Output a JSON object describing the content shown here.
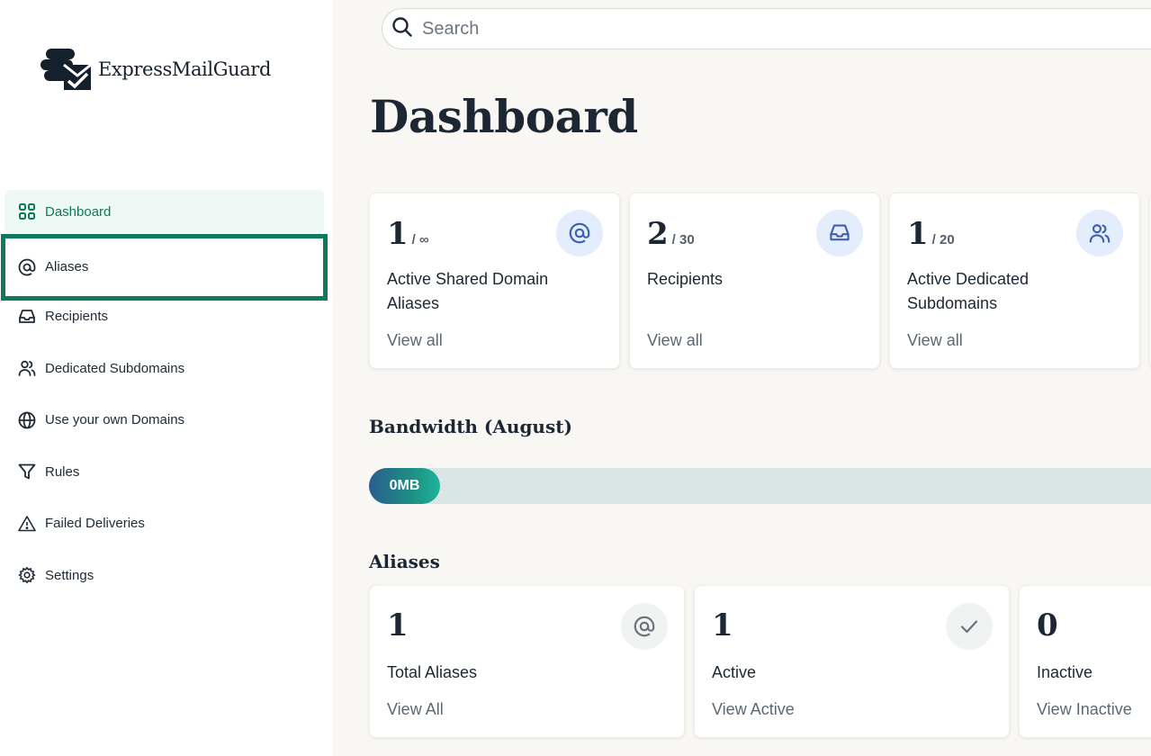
{
  "app": {
    "brand": "ExpressMailGuard"
  },
  "search": {
    "placeholder": "Search"
  },
  "sidebar": {
    "items": [
      {
        "label": "Dashboard",
        "icon": "grid-icon"
      },
      {
        "label": "Aliases",
        "icon": "at-icon"
      },
      {
        "label": "Recipients",
        "icon": "inbox-icon"
      },
      {
        "label": "Dedicated Subdomains",
        "icon": "users-icon"
      },
      {
        "label": "Use your own Domains",
        "icon": "globe-icon"
      },
      {
        "label": "Rules",
        "icon": "filter-icon"
      },
      {
        "label": "Failed Deliveries",
        "icon": "warning-icon"
      },
      {
        "label": "Settings",
        "icon": "gear-icon"
      }
    ]
  },
  "main": {
    "title": "Dashboard",
    "stats": [
      {
        "value": "1",
        "limit": "/ ∞",
        "label": "Active Shared Domain Aliases",
        "link": "View all",
        "icon": "at-icon"
      },
      {
        "value": "2",
        "limit": "/ 30",
        "label": "Recipients",
        "link": "View all",
        "icon": "inbox-icon"
      },
      {
        "value": "1",
        "limit": "/ 20",
        "label": "Active Dedicated Subdomains",
        "link": "View all",
        "icon": "users-icon"
      }
    ],
    "bandwidth": {
      "title": "Bandwidth (August)",
      "value": "0MB",
      "progress_percent": 0
    },
    "aliases": {
      "title": "Aliases",
      "cards": [
        {
          "value": "1",
          "label": "Total Aliases",
          "link": "View All",
          "icon": "at-icon"
        },
        {
          "value": "1",
          "label": "Active",
          "link": "View Active",
          "icon": "check-icon"
        },
        {
          "value": "0",
          "label": "Inactive",
          "link": "View Inactive",
          "icon": ""
        }
      ]
    }
  },
  "colors": {
    "accent": "#0c7a5c",
    "active_bg": "#eef8f4",
    "icon_blue": "#3f5fb0",
    "background": "#f8f7f4"
  }
}
